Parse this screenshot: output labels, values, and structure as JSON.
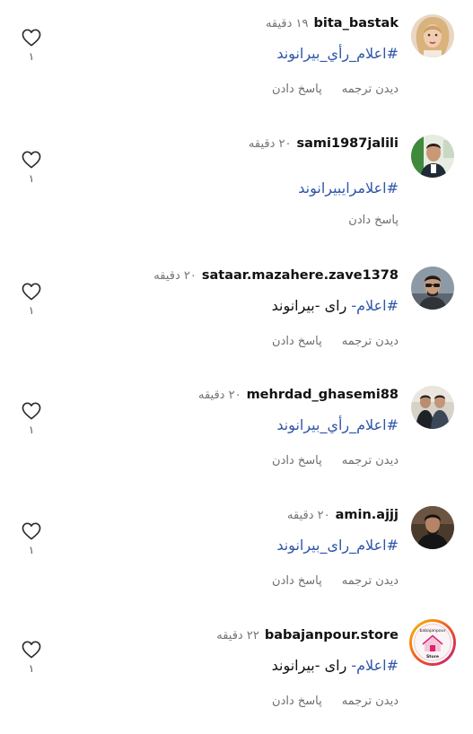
{
  "comments": [
    {
      "username": "bita_bastak",
      "time": "۱۹ دقیقه",
      "text_hashtag": "#اعلام_رأي_بيرانوند",
      "text_rest": "",
      "reply_label": "پاسخ دادن",
      "translate_label": "دیدن ترجمه",
      "like_count": "۱",
      "avatar_icon": "avatar-woman-blonde"
    },
    {
      "username": "sami1987jalili",
      "time": "۲۰ دقیقه",
      "text_hashtag": "#اعلامرایبیرانوند",
      "text_rest": "",
      "reply_label": "پاسخ دادن",
      "translate_label": "",
      "like_count": "۱",
      "avatar_icon": "avatar-man-green"
    },
    {
      "username": "sataar.mazahere.zave1378",
      "time": "۲۰ دقیقه",
      "text_hashtag": "#اعلام-",
      "text_rest": " رای -بیرانوند",
      "reply_label": "پاسخ دادن",
      "translate_label": "دیدن ترجمه",
      "like_count": "۱",
      "avatar_icon": "avatar-man-sunglasses"
    },
    {
      "username": "mehrdad_ghasemi88",
      "time": "۲۰ دقیقه",
      "text_hashtag": "#اعلام_رأي_بيرانوند",
      "text_rest": "",
      "reply_label": "پاسخ دادن",
      "translate_label": "دیدن ترجمه",
      "like_count": "۱",
      "avatar_icon": "avatar-two-men"
    },
    {
      "username": "amin.ajjj",
      "time": "۲۰ دقیقه",
      "text_hashtag": "#اعلام_رای_بیرانوند",
      "text_rest": "",
      "reply_label": "پاسخ دادن",
      "translate_label": "دیدن ترجمه",
      "like_count": "۱",
      "avatar_icon": "avatar-man-dark"
    },
    {
      "username": "babajanpour.store",
      "time": "۲۲ دقیقه",
      "text_hashtag": "#اعلام-",
      "text_rest": " رای -بیرانوند",
      "reply_label": "پاسخ دادن",
      "translate_label": "دیدن ترجمه",
      "like_count": "۱",
      "avatar_icon": "avatar-store-logo",
      "avatar_logo_text_top": "babajanpour",
      "avatar_logo_text_bottom": "Store"
    }
  ],
  "colors": {
    "hashtag": "#2f56a9",
    "secondary_text": "#737373",
    "primary_text": "#111111"
  }
}
